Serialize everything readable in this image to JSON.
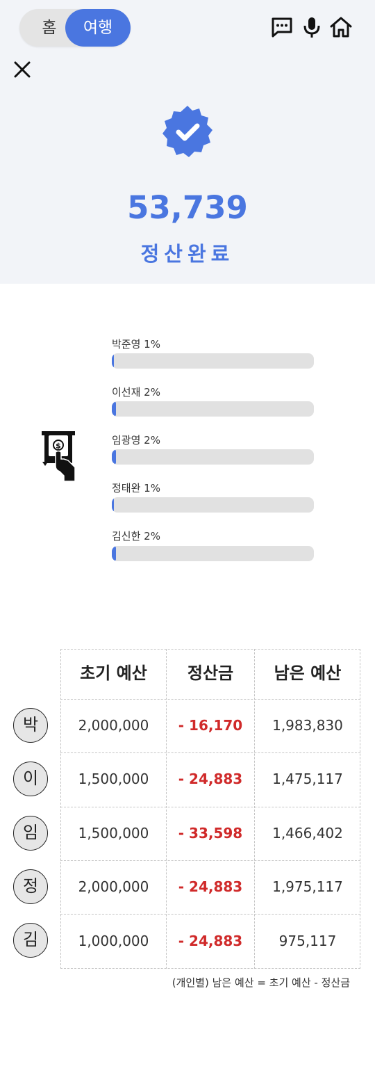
{
  "header": {
    "toggle": {
      "home_label": "홈",
      "travel_label": "여행",
      "selected": "여행"
    },
    "icons": [
      "chat-icon",
      "mic-icon",
      "home-icon"
    ]
  },
  "close_icon": "close-icon",
  "result": {
    "badge_icon": "verified-check-icon",
    "amount": "53,739",
    "status": "정산완료"
  },
  "illustration_icon": "atm-cash-withdraw-icon",
  "bars": [
    {
      "label": "박준영 1%",
      "percent": 1
    },
    {
      "label": "이선재 2%",
      "percent": 2
    },
    {
      "label": "임광영 2%",
      "percent": 2
    },
    {
      "label": "정태완 1%",
      "percent": 1
    },
    {
      "label": "김신한 2%",
      "percent": 2
    }
  ],
  "table": {
    "headers": [
      "초기 예산",
      "정산금",
      "남은 예산"
    ],
    "rows": [
      {
        "avatar": "박",
        "initial": "2,000,000",
        "settlement": "- 16,170",
        "remaining": "1,983,830"
      },
      {
        "avatar": "이",
        "initial": "1,500,000",
        "settlement": "- 24,883",
        "remaining": "1,475,117"
      },
      {
        "avatar": "임",
        "initial": "1,500,000",
        "settlement": "- 33,598",
        "remaining": "1,466,402"
      },
      {
        "avatar": "정",
        "initial": "2,000,000",
        "settlement": "- 24,883",
        "remaining": "1,975,117"
      },
      {
        "avatar": "김",
        "initial": "1,000,000",
        "settlement": "- 24,883",
        "remaining": "975,117"
      }
    ],
    "note": "(개인별) 남은 예산 = 초기 예산 - 정산금"
  },
  "colors": {
    "accent": "#4a76e0",
    "negative": "#d02a2a",
    "top_bg": "#f2f4f8",
    "track": "#e1e1e1"
  }
}
